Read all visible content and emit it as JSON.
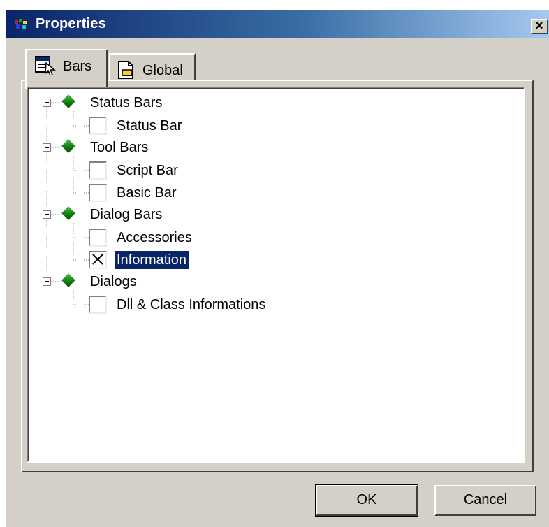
{
  "window": {
    "title": "Properties",
    "close_label": "×"
  },
  "tabs": [
    {
      "label": "Bars",
      "icon": "bars-icon",
      "active": true
    },
    {
      "label": "Global",
      "icon": "global-icon",
      "active": false
    }
  ],
  "tree": {
    "groups": [
      {
        "label": "Status Bars",
        "items": [
          {
            "label": "Status Bar",
            "checked": false
          }
        ]
      },
      {
        "label": "Tool Bars",
        "items": [
          {
            "label": "Script Bar",
            "checked": false
          },
          {
            "label": "Basic Bar",
            "checked": false
          }
        ]
      },
      {
        "label": "Dialog Bars",
        "items": [
          {
            "label": "Accessories",
            "checked": false
          },
          {
            "label": "Information",
            "checked": true,
            "selected": true
          }
        ]
      },
      {
        "label": "Dialogs",
        "items": [
          {
            "label": "Dll & Class Informations",
            "checked": false
          }
        ]
      }
    ]
  },
  "buttons": {
    "ok_label": "OK",
    "cancel_label": "Cancel"
  },
  "colors": {
    "title_active": "#0a246a",
    "selection": "#0a246a",
    "face": "#d4d0c8",
    "node_icon": "#1a8f1a"
  }
}
